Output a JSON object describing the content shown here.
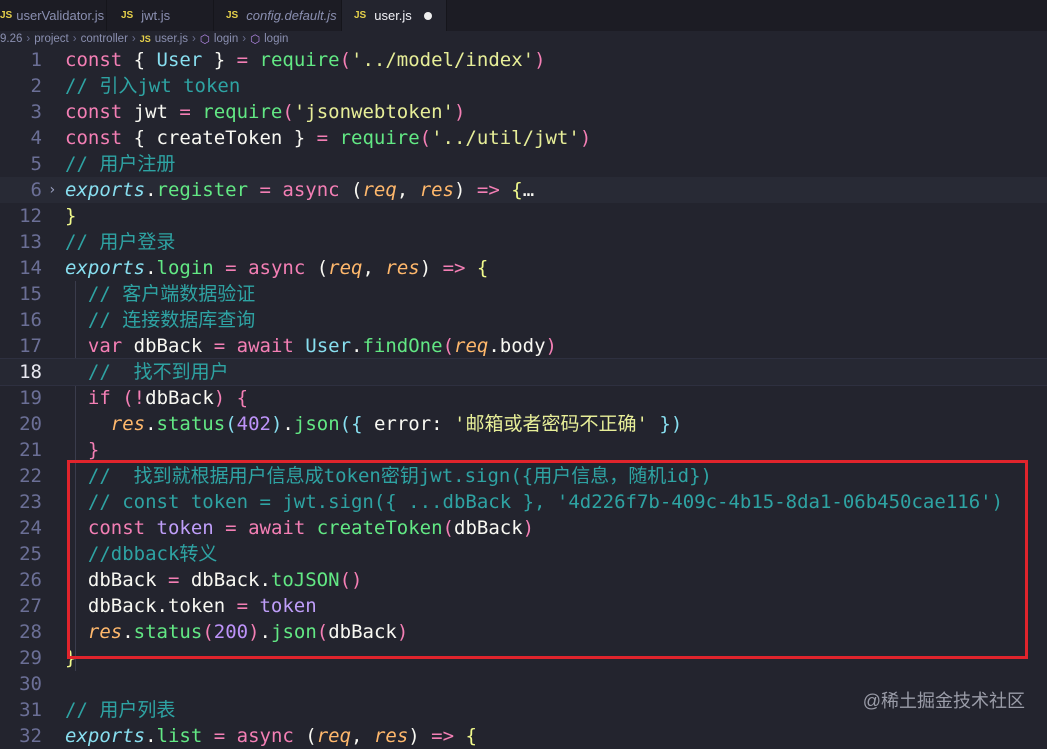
{
  "tabs": [
    {
      "label": "userValidator.js",
      "icon": "js-icon"
    },
    {
      "label": "jwt.js",
      "icon": "js-icon"
    },
    {
      "label": "config.default.js",
      "icon": "js-icon"
    },
    {
      "label": "user.js",
      "icon": "js-icon",
      "active": true,
      "modified": true
    }
  ],
  "js_badge": "JS",
  "breadcrumb": [
    "9.26",
    "project",
    "controller",
    "user.js",
    "login",
    "login"
  ],
  "watermark": "@稀土掘金技术社区",
  "colors": {
    "highlight_box": "#e0242c",
    "background": "#23242e"
  },
  "code": {
    "lines": [
      {
        "n": "1",
        "t": [
          [
            "kw",
            "const "
          ],
          [
            "pl",
            "{ "
          ],
          [
            "cls",
            "User"
          ],
          [
            "pl",
            " } "
          ],
          [
            "op",
            "= "
          ],
          [
            "fn",
            "require"
          ],
          [
            "pn",
            "("
          ],
          [
            "str",
            "'../model/index'"
          ],
          [
            "pn",
            ")"
          ]
        ]
      },
      {
        "n": "2",
        "t": [
          [
            "cm",
            "// 引入jwt token"
          ]
        ]
      },
      {
        "n": "3",
        "t": [
          [
            "kw",
            "const "
          ],
          [
            "pl",
            "jwt "
          ],
          [
            "op",
            "= "
          ],
          [
            "fn",
            "require"
          ],
          [
            "pn",
            "("
          ],
          [
            "str",
            "'jsonwebtoken'"
          ],
          [
            "pn",
            ")"
          ]
        ]
      },
      {
        "n": "4",
        "t": [
          [
            "kw",
            "const "
          ],
          [
            "pl",
            "{ createToken } "
          ],
          [
            "op",
            "= "
          ],
          [
            "fn",
            "require"
          ],
          [
            "pn",
            "("
          ],
          [
            "str",
            "'../util/jwt'"
          ],
          [
            "pn",
            ")"
          ]
        ]
      },
      {
        "n": "5",
        "t": [
          [
            "cm",
            "// 用户注册"
          ]
        ]
      },
      {
        "n": "6",
        "fold": true,
        "t": [
          [
            "obj",
            "exports"
          ],
          [
            "pl",
            "."
          ],
          [
            "fn",
            "register"
          ],
          [
            "op",
            " = "
          ],
          [
            "kw",
            "async "
          ],
          [
            "pl",
            "("
          ],
          [
            "par",
            "req"
          ],
          [
            "pl",
            ", "
          ],
          [
            "par",
            "res"
          ],
          [
            "pl",
            ") "
          ],
          [
            "kw",
            "=> "
          ],
          [
            "br",
            "{"
          ],
          [
            "pl",
            "…"
          ]
        ]
      },
      {
        "n": "12",
        "t": [
          [
            "br",
            "}"
          ]
        ]
      },
      {
        "n": "13",
        "t": [
          [
            "cm",
            "// 用户登录"
          ]
        ]
      },
      {
        "n": "14",
        "t": [
          [
            "obj",
            "exports"
          ],
          [
            "pl",
            "."
          ],
          [
            "fn",
            "login"
          ],
          [
            "op",
            " = "
          ],
          [
            "kw",
            "async "
          ],
          [
            "pl",
            "("
          ],
          [
            "par",
            "req"
          ],
          [
            "pl",
            ", "
          ],
          [
            "par",
            "res"
          ],
          [
            "pl",
            ") "
          ],
          [
            "kw",
            "=> "
          ],
          [
            "br",
            "{"
          ]
        ]
      },
      {
        "n": "15",
        "t": [
          [
            "pl",
            "  "
          ],
          [
            "cm",
            "// 客户端数据验证"
          ]
        ]
      },
      {
        "n": "16",
        "t": [
          [
            "pl",
            "  "
          ],
          [
            "cm",
            "// 连接数据库查询"
          ]
        ]
      },
      {
        "n": "17",
        "t": [
          [
            "pl",
            "  "
          ],
          [
            "kw",
            "var "
          ],
          [
            "pl",
            "dbBack "
          ],
          [
            "op",
            "= "
          ],
          [
            "kw",
            "await "
          ],
          [
            "cls",
            "User"
          ],
          [
            "pl",
            "."
          ],
          [
            "fn",
            "findOne"
          ],
          [
            "pn",
            "("
          ],
          [
            "par",
            "req"
          ],
          [
            "pl",
            ".body"
          ],
          [
            "pn",
            ")"
          ]
        ]
      },
      {
        "n": "18",
        "cur": true,
        "t": [
          [
            "pl",
            "  "
          ],
          [
            "cm",
            "//  找不到用户"
          ]
        ]
      },
      {
        "n": "19",
        "t": [
          [
            "pl",
            "  "
          ],
          [
            "kw",
            "if "
          ],
          [
            "pn",
            "("
          ],
          [
            "kw",
            "!"
          ],
          [
            "pl",
            "dbBack"
          ],
          [
            "pn",
            ")"
          ],
          [
            "pl",
            " "
          ],
          [
            "kw",
            "{"
          ]
        ]
      },
      {
        "n": "20",
        "t": [
          [
            "pl",
            "    "
          ],
          [
            "par",
            "res"
          ],
          [
            "pl",
            "."
          ],
          [
            "fn",
            "status"
          ],
          [
            "cls",
            "("
          ],
          [
            "num",
            "402"
          ],
          [
            "cls",
            ")"
          ],
          [
            "pl",
            "."
          ],
          [
            "fn",
            "json"
          ],
          [
            "cls",
            "({"
          ],
          [
            "pl",
            " error: "
          ],
          [
            "str",
            "'邮箱或者密码不正确'"
          ],
          [
            "cls",
            " })"
          ]
        ]
      },
      {
        "n": "21",
        "t": [
          [
            "pl",
            "  "
          ],
          [
            "kw",
            "}"
          ]
        ]
      },
      {
        "n": "22",
        "t": [
          [
            "pl",
            "  "
          ],
          [
            "cm",
            "//  找到就根据用户信息成token密钥jwt.sign({用户信息，随机id})"
          ]
        ]
      },
      {
        "n": "23",
        "t": [
          [
            "pl",
            "  "
          ],
          [
            "cm",
            "// const token = jwt.sign({ ...dbBack }, '4d226f7b-409c-4b15-8da1-06b450cae116')"
          ]
        ]
      },
      {
        "n": "24",
        "t": [
          [
            "pl",
            "  "
          ],
          [
            "kw",
            "const "
          ],
          [
            "var",
            "token "
          ],
          [
            "op",
            "= "
          ],
          [
            "kw",
            "await "
          ],
          [
            "fn",
            "createToken"
          ],
          [
            "pn",
            "("
          ],
          [
            "pl",
            "dbBack"
          ],
          [
            "pn",
            ")"
          ]
        ]
      },
      {
        "n": "25",
        "t": [
          [
            "pl",
            "  "
          ],
          [
            "cm",
            "//dbback转义"
          ]
        ]
      },
      {
        "n": "26",
        "t": [
          [
            "pl",
            "  dbBack "
          ],
          [
            "op",
            "= "
          ],
          [
            "pl",
            "dbBack."
          ],
          [
            "fn",
            "toJSON"
          ],
          [
            "pn",
            "()"
          ]
        ]
      },
      {
        "n": "27",
        "t": [
          [
            "pl",
            "  dbBack.token "
          ],
          [
            "op",
            "= "
          ],
          [
            "var",
            "token"
          ]
        ]
      },
      {
        "n": "28",
        "t": [
          [
            "pl",
            "  "
          ],
          [
            "par",
            "res"
          ],
          [
            "pl",
            "."
          ],
          [
            "fn",
            "status"
          ],
          [
            "pn",
            "("
          ],
          [
            "num",
            "200"
          ],
          [
            "pn",
            ")"
          ],
          [
            "pl",
            "."
          ],
          [
            "fn",
            "json"
          ],
          [
            "pn",
            "("
          ],
          [
            "pl",
            "dbBack"
          ],
          [
            "pn",
            ")"
          ]
        ]
      },
      {
        "n": "29",
        "t": [
          [
            "br",
            "}"
          ]
        ]
      },
      {
        "n": "30",
        "t": []
      },
      {
        "n": "31",
        "t": [
          [
            "cm",
            "// 用户列表"
          ]
        ]
      },
      {
        "n": "32",
        "t": [
          [
            "obj",
            "exports"
          ],
          [
            "pl",
            "."
          ],
          [
            "fn",
            "list"
          ],
          [
            "op",
            " = "
          ],
          [
            "kw",
            "async "
          ],
          [
            "pl",
            "("
          ],
          [
            "par",
            "req"
          ],
          [
            "pl",
            ", "
          ],
          [
            "par",
            "res"
          ],
          [
            "pl",
            ") "
          ],
          [
            "kw",
            "=> "
          ],
          [
            "br",
            "{"
          ]
        ]
      }
    ]
  }
}
